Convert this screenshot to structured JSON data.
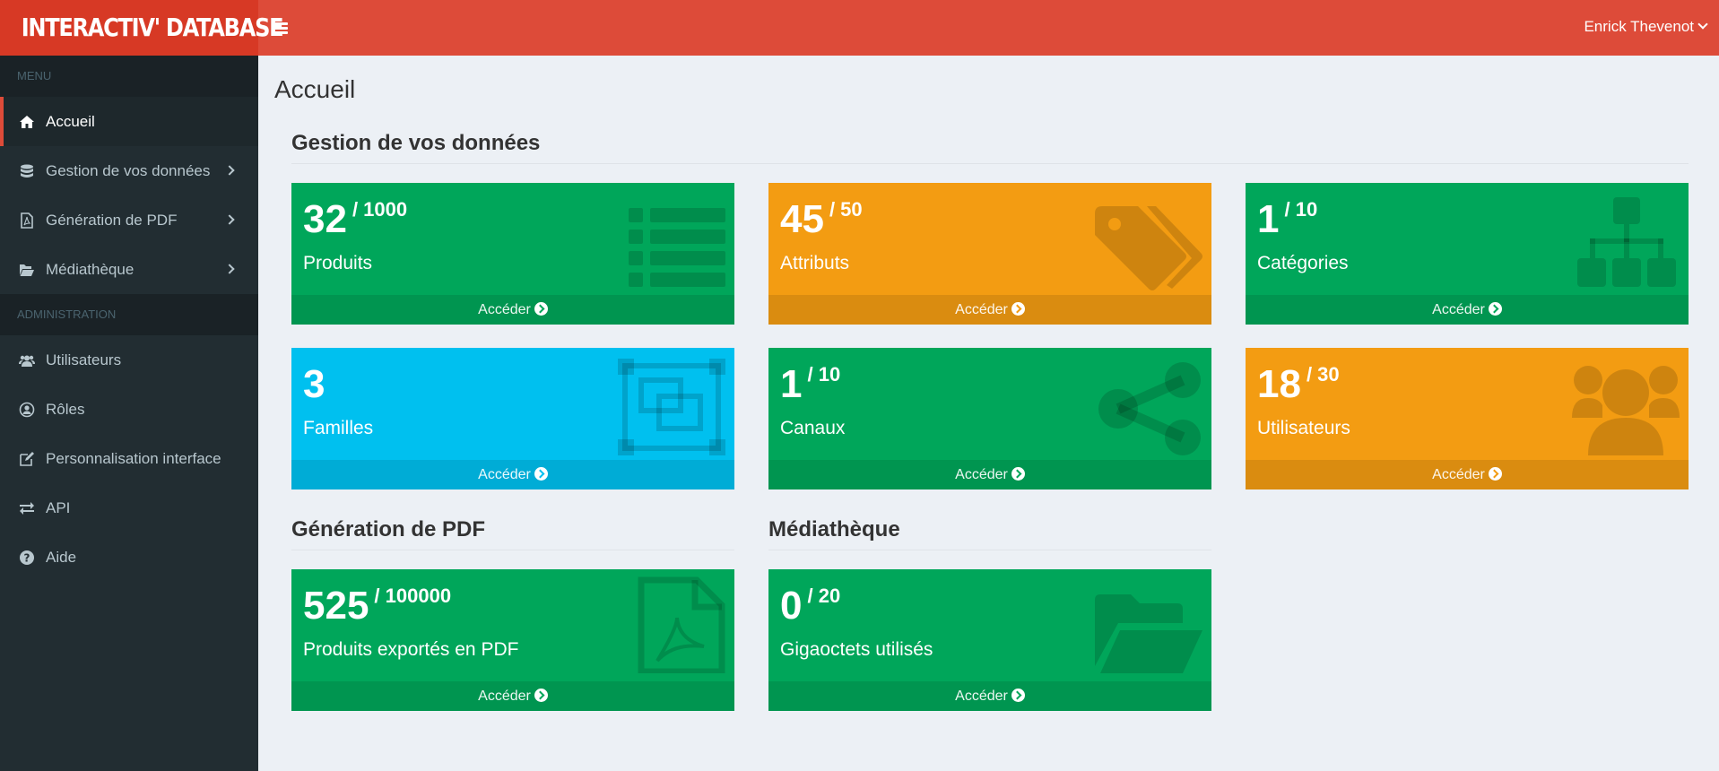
{
  "header": {
    "logo": "INTERACTIV' DATABASE",
    "user_name": "Enrick Thevenot",
    "color": "#dd4b39"
  },
  "sidebar": {
    "menu_header": "MENU",
    "admin_header": "ADMINISTRATION",
    "menu_items": [
      {
        "label": "Accueil",
        "icon": "home-icon",
        "active": true
      },
      {
        "label": "Gestion de vos données",
        "icon": "database-icon",
        "submenu": true
      },
      {
        "label": "Génération de PDF",
        "icon": "pdf-file-icon",
        "submenu": true
      },
      {
        "label": "Médiathèque",
        "icon": "folder-open-icon",
        "submenu": true
      }
    ],
    "admin_items": [
      {
        "label": "Utilisateurs",
        "icon": "users-icon"
      },
      {
        "label": "Rôles",
        "icon": "user-circle-icon"
      },
      {
        "label": "Personnalisation interface",
        "icon": "edit-icon"
      },
      {
        "label": "API",
        "icon": "exchange-icon"
      },
      {
        "label": "Aide",
        "icon": "question-circle-icon"
      }
    ]
  },
  "main": {
    "page_title": "Accueil",
    "sections": [
      {
        "title": "Gestion de vos données"
      },
      {
        "title": "Génération de PDF"
      },
      {
        "title": "Médiathèque"
      }
    ],
    "footer_label": "Accéder",
    "boxes": [
      {
        "value": "32",
        "max": "/ 1000",
        "label": "Produits",
        "color": "green",
        "icon": "list-icon"
      },
      {
        "value": "45",
        "max": "/ 50",
        "label": "Attributs",
        "color": "orange",
        "icon": "tags-icon"
      },
      {
        "value": "1",
        "max": "/ 10",
        "label": "Catégories",
        "color": "green",
        "icon": "sitemap-icon"
      },
      {
        "value": "3",
        "max": "",
        "label": "Familles",
        "color": "aqua",
        "icon": "object-group-icon"
      },
      {
        "value": "1",
        "max": "/ 10",
        "label": "Canaux",
        "color": "green",
        "icon": "share-alt-icon"
      },
      {
        "value": "18",
        "max": "/ 30",
        "label": "Utilisateurs",
        "color": "orange",
        "icon": "users-icon"
      },
      {
        "value": "525",
        "max": "/ 100000",
        "label": "Produits exportés en PDF",
        "color": "green",
        "icon": "pdf-file-icon"
      },
      {
        "value": "0",
        "max": "/ 20",
        "label": "Gigaoctets utilisés",
        "color": "green",
        "icon": "folder-open-icon"
      }
    ]
  },
  "colors": {
    "green": "#00a65a",
    "orange": "#f39c12",
    "aqua": "#00c0ef",
    "sidebar": "#222d32"
  }
}
